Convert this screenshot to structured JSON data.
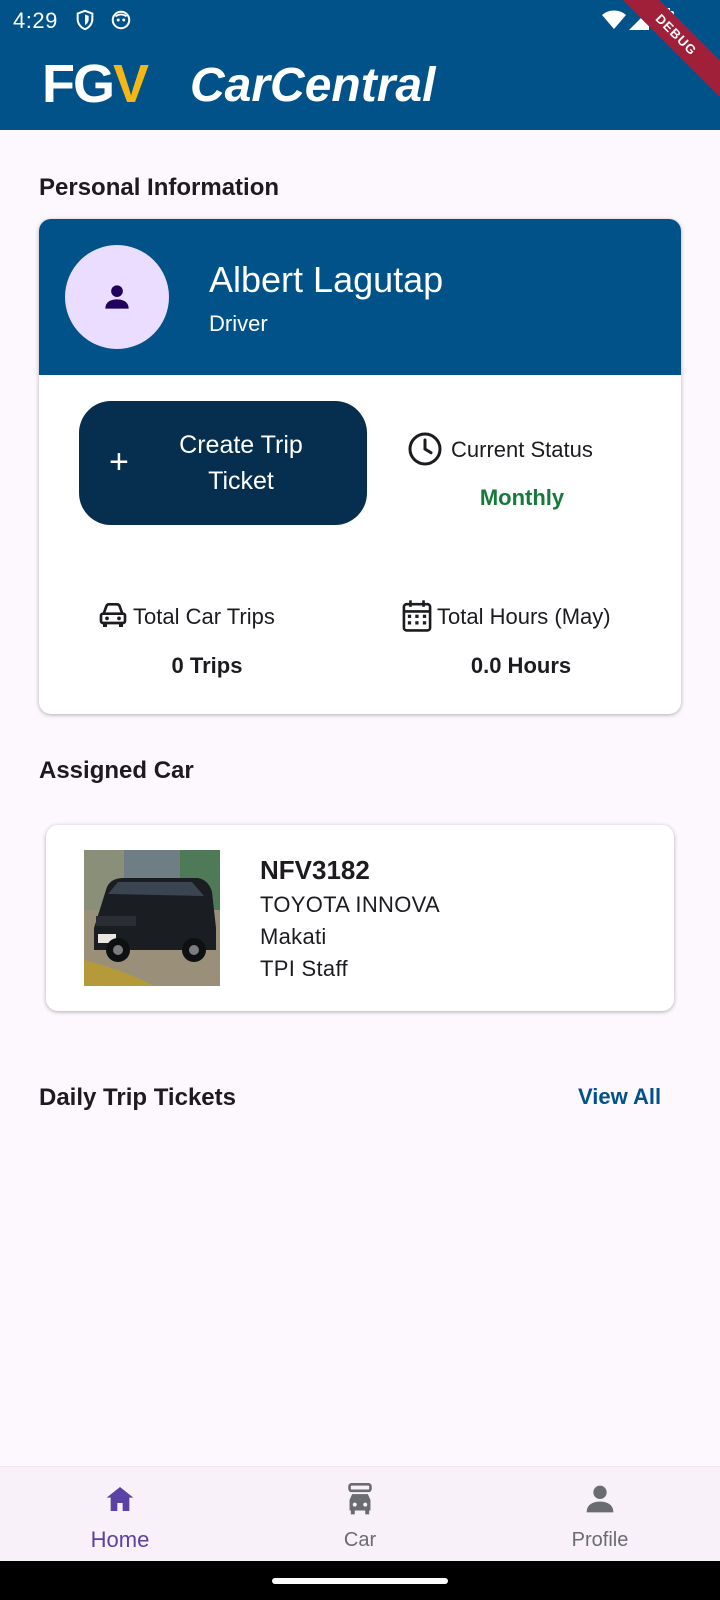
{
  "status_bar": {
    "time": "4:29",
    "debug_label": "DEBUG"
  },
  "app_logo": {
    "fgv_prefix": "FG",
    "fgv_v": "V",
    "product": "CarCentral"
  },
  "sections": {
    "personal_info": "Personal Information",
    "assigned_car": "Assigned Car",
    "daily_trips": "Daily Trip Tickets",
    "view_all": "View All"
  },
  "profile": {
    "name": "Albert Lagutap",
    "role": "Driver"
  },
  "create_trip": {
    "plus": "+",
    "label": "Create Trip Ticket"
  },
  "current_status": {
    "label": "Current Status",
    "value": "Monthly"
  },
  "stats": {
    "car_trips_label": "Total Car Trips",
    "car_trips_value": "0 Trips",
    "hours_label": "Total Hours (May)",
    "hours_value": "0.0 Hours"
  },
  "car": {
    "plate": "NFV3182",
    "model": "TOYOTA INNOVA",
    "location": "Makati",
    "assignment": "TPI Staff"
  },
  "bottom_nav": {
    "home": "Home",
    "car": "Car",
    "profile": "Profile"
  },
  "colors": {
    "primary": "#02528a",
    "button_dark": "#062e4f",
    "status_green": "#157a3a",
    "nav_active": "#5a41a6"
  }
}
